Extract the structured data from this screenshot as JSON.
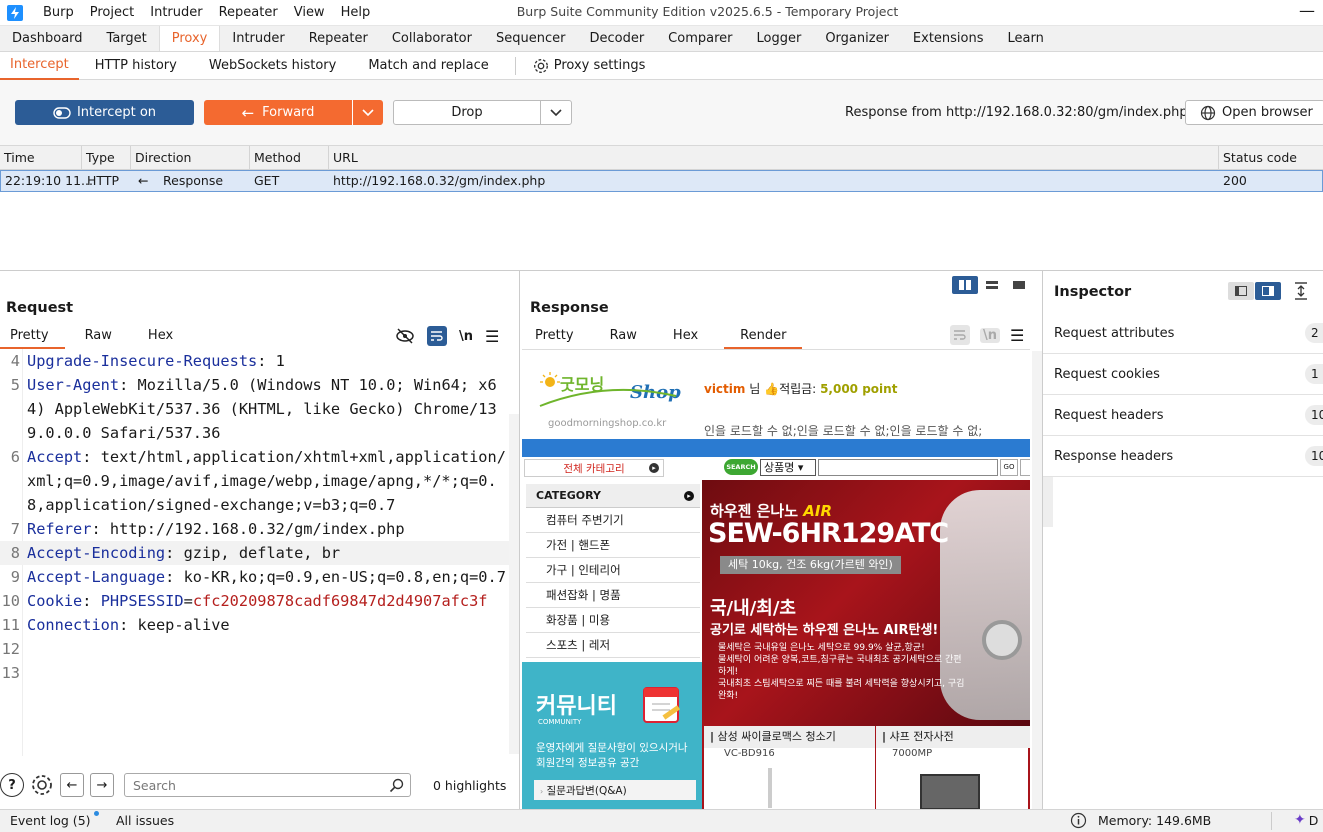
{
  "app": {
    "title": "Burp Suite Community Edition v2025.6.5 - Temporary Project",
    "menu": [
      "Burp",
      "Project",
      "Intruder",
      "Repeater",
      "View",
      "Help"
    ]
  },
  "tabs": [
    "Dashboard",
    "Target",
    "Proxy",
    "Intruder",
    "Repeater",
    "Collaborator",
    "Sequencer",
    "Decoder",
    "Comparer",
    "Logger",
    "Organizer",
    "Extensions",
    "Learn"
  ],
  "subtabs": {
    "intercept": "Intercept",
    "http_history": "HTTP history",
    "websockets": "WebSockets history",
    "match_replace": "Match and replace",
    "settings": "Proxy settings"
  },
  "toolbar": {
    "intercept": "Intercept on",
    "forward": "Forward",
    "drop": "Drop",
    "response_from": "Response from http://192.168.0.32:80/gm/index.php",
    "open_browser": "Open browser"
  },
  "table": {
    "headers": {
      "time": "Time",
      "type": "Type",
      "direction": "Direction",
      "method": "Method",
      "url": "URL",
      "status": "Status code"
    },
    "row": {
      "time": "22:19:10 11...",
      "type": "HTTP",
      "direction": "Response",
      "method": "GET",
      "url": "http://192.168.0.32/gm/index.php",
      "status": "200"
    }
  },
  "request": {
    "title": "Request",
    "tabs": {
      "pretty": "Pretty",
      "raw": "Raw",
      "hex": "Hex"
    },
    "newline_toggle": "\\n",
    "lines": [
      {
        "n": "4",
        "k": "Upgrade-Insecure-Requests",
        "v": " 1"
      },
      {
        "n": "5",
        "k": "User-Agent",
        "v": " Mozilla/5.0 (Windows NT 10.0; Win64; x64) AppleWebKit/537.36 (KHTML, like Gecko) Chrome/139.0.0.0 Safari/537.36"
      },
      {
        "n": "6",
        "k": "Accept",
        "v": " text/html,application/xhtml+xml,application/xml;q=0.9,image/avif,image/webp,image/apng,*/*;q=0.8,application/signed-exchange;v=b3;q=0.7"
      },
      {
        "n": "7",
        "k": "Referer",
        "v": " http://192.168.0.32/gm/index.php"
      },
      {
        "n": "8",
        "k": "Accept-Encoding",
        "v": " gzip, deflate, br"
      },
      {
        "n": "9",
        "k": "Accept-Language",
        "v": " ko-KR,ko;q=0.9,en-US;q=0.8,en;q=0.7"
      },
      {
        "n": "10",
        "k": "Cookie",
        "v": " ",
        "ck": "PHPSESSID",
        "cv": "cfc20209878cadf69847d2d4907afc3f"
      },
      {
        "n": "11",
        "k": "Connection",
        "v": " keep-alive"
      },
      {
        "n": "12",
        "k": "",
        "v": ""
      },
      {
        "n": "13",
        "k": "",
        "v": ""
      }
    ],
    "search_placeholder": "Search",
    "highlights": "0 highlights"
  },
  "response": {
    "title": "Response",
    "tabs": {
      "pretty": "Pretty",
      "raw": "Raw",
      "hex": "Hex",
      "render": "Render"
    },
    "newline_toggle": "\\n"
  },
  "render": {
    "logo_sub": "goodmorningshop.co.kr",
    "user": "victim",
    "nim": "님",
    "points_label": "적립금:",
    "points": "5,000 point",
    "broken": "인을 로드할 수 없;인을 로드할 수 없;인을 로드할 수 없;",
    "all_cat": "전체 카테고리",
    "search_btn": "SEARCH",
    "search_select": "상품명",
    "go": "GO",
    "category_title": "CATEGORY",
    "categories": [
      "컴퓨터 주변기기",
      "가전 | 핸드폰",
      "가구 | 인테리어",
      "패션잡화 | 명품",
      "화장품 | 미용",
      "스포츠 | 레저"
    ],
    "community": "커뮤니티",
    "community_en": "COMMUNITY",
    "community_desc": "운영자에게 질문사항이 있으시거나 회원간의 정보공유 공간",
    "qa": "질문과답변(Q&A)",
    "banner_brand": "하우젠 은나노",
    "banner_air": "AIR",
    "banner_model": "SEW-6HR129ATC",
    "banner_spec": "세탁 10kg, 건조 6kg(가르텐 와인)",
    "banner_slogan1": "국/내/최/초",
    "banner_slogan2": "공기로 세탁하는 하우젠 은나노 AIR탄생!",
    "banner_bullets": [
      "물세탁은 국내유일 은나노 세탁으로 99.9% 살균,항균!",
      "물세탁이 어려운 양복,코트,침구류는 국내최초 공기세탁으로 간편하게!",
      "국내최초 스팀세탁으로 찌든 때를 불려 세탁력을 향상시키고, 구김 완화!"
    ],
    "prod1": "삼성 싸이클로맥스 청소기",
    "prod1_model": "VC-BD916",
    "prod2": "샤프 전자사전",
    "prod2_model": "7000MP"
  },
  "inspector": {
    "title": "Inspector",
    "rows": [
      {
        "label": "Request attributes",
        "count": "2"
      },
      {
        "label": "Request cookies",
        "count": "1"
      },
      {
        "label": "Request headers",
        "count": "10"
      },
      {
        "label": "Response headers",
        "count": "10"
      }
    ]
  },
  "status": {
    "event_log": "Event log (5)",
    "all_issues": "All issues",
    "memory": "Memory: 149.6MB",
    "d": "D"
  }
}
